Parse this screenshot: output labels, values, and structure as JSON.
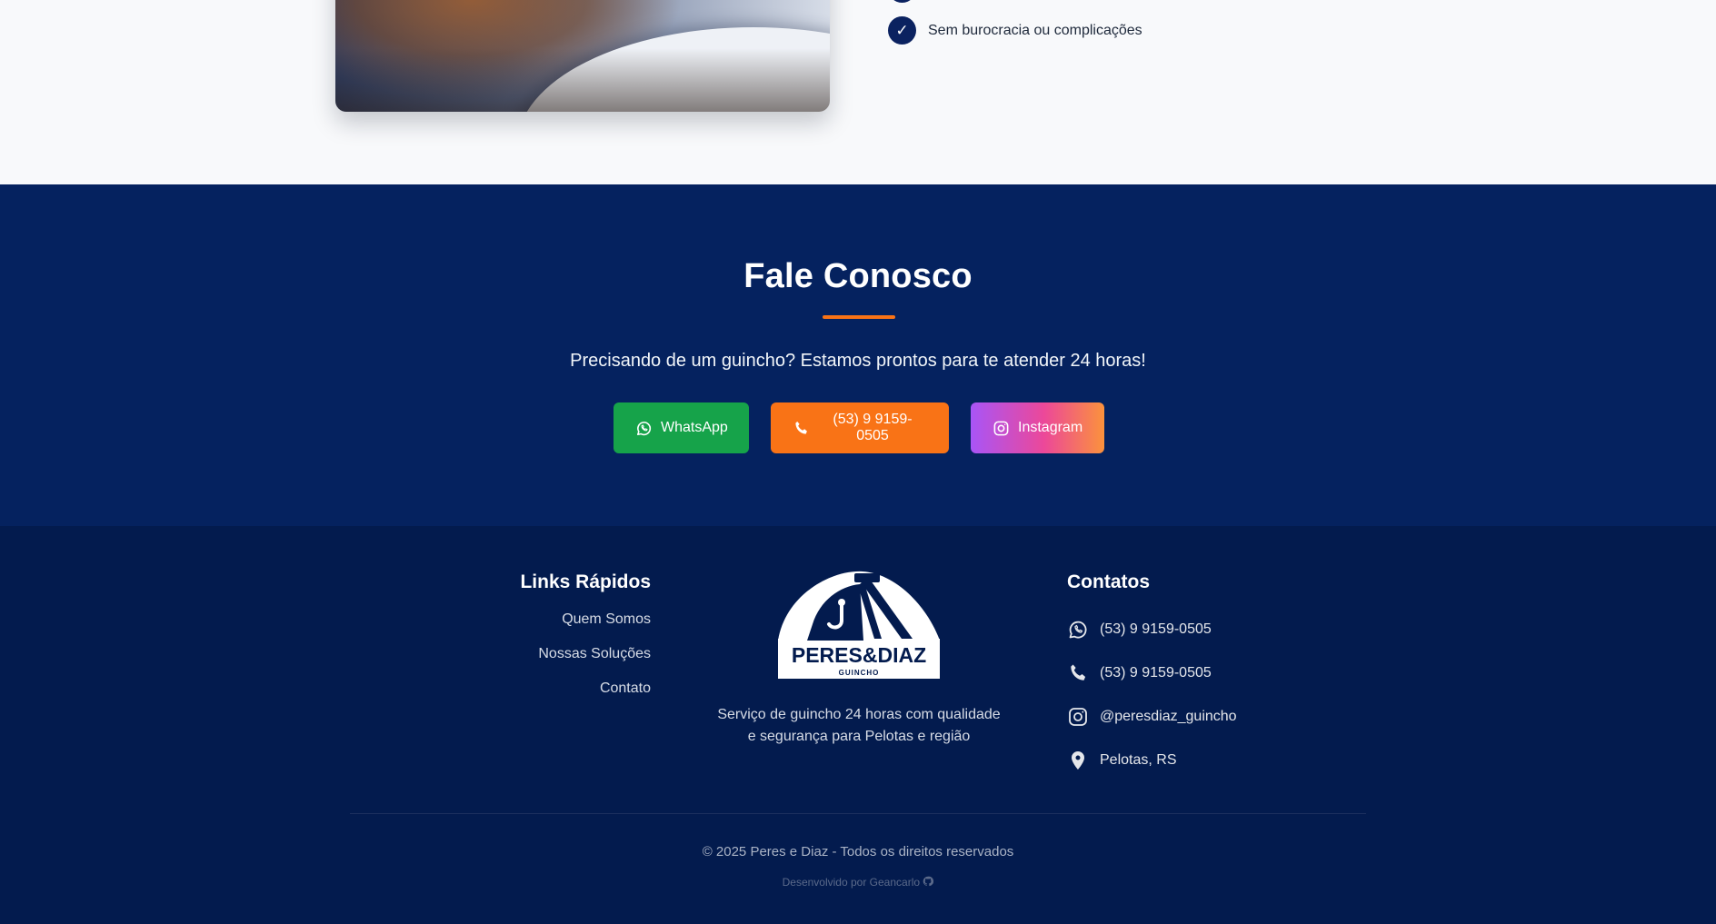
{
  "about": {
    "checklist": [
      {
        "label": "Sem burocracia ou complicações"
      }
    ]
  },
  "contact": {
    "title": "Fale Conosco",
    "subtitle": "Precisando de um guincho? Estamos prontos para te atender 24 horas!",
    "buttons": {
      "whatsapp": "WhatsApp",
      "phone": "(53) 9 9159-0505",
      "instagram": "Instagram"
    }
  },
  "footer": {
    "quick_links": {
      "title": "Links Rápidos",
      "items": [
        "Quem Somos",
        "Nossas Soluções",
        "Contato"
      ]
    },
    "brand": {
      "logo_text": "PERES&DIAZ",
      "logo_subtext": "GUINCHO",
      "description_line1": "Serviço de guincho 24 horas com qualidade",
      "description_line2": "e segurança para Pelotas e região"
    },
    "contacts": {
      "title": "Contatos",
      "whatsapp": "(53) 9 9159-0505",
      "phone": "(53) 9 9159-0505",
      "instagram": "@peresdiaz_guincho",
      "location": "Pelotas, RS"
    },
    "copyright": "© 2025 Peres e Diaz - Todos os direitos reservados",
    "developer": "Desenvolvido por Geancarlo"
  },
  "colors": {
    "navy": "#05225f",
    "footer_navy": "#031b4e",
    "accent_orange": "#f97316",
    "whatsapp_green": "#16a34a"
  },
  "icons": [
    "check-icon",
    "whatsapp-icon",
    "phone-icon",
    "instagram-icon",
    "location-pin-icon",
    "github-icon"
  ]
}
